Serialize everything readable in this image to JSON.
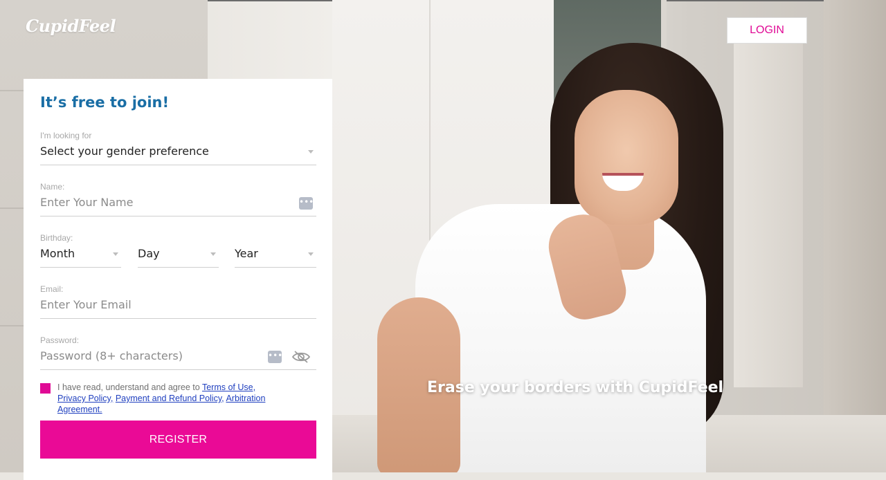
{
  "header": {
    "logo_text": "CupidFeel",
    "login_label": "LOGIN"
  },
  "form": {
    "title": "It’s free to join!",
    "looking_for": {
      "label": "I'm looking for",
      "value": "Select your gender preference"
    },
    "name": {
      "label": "Name:",
      "placeholder": "Enter Your Name"
    },
    "birthday": {
      "label": "Birthday:",
      "month": "Month",
      "day": "Day",
      "year": "Year"
    },
    "email": {
      "label": "Email:",
      "placeholder": "Enter Your Email"
    },
    "password": {
      "label": "Password:",
      "placeholder": "Password (8+ characters)"
    },
    "consent": {
      "prefix": "I have read, understand and agree to ",
      "terms_link": "Terms of Use,",
      "privacy_link": "Privacy Policy,",
      "refund_link": "Payment and Refund Policy,",
      "arbitration_link": "Arbitration Agreement."
    },
    "register_label": "REGISTER"
  },
  "hero": {
    "tagline": "Erase your borders with CupidFeel"
  },
  "colors": {
    "accent": "#ea0a96",
    "title_blue": "#1a6ea5",
    "link_blue": "#1f3fbf"
  },
  "icons": {
    "name_field_icon": "dots-icon",
    "password_dots_icon": "dots-icon",
    "password_toggle_icon": "eye-slash-icon"
  }
}
